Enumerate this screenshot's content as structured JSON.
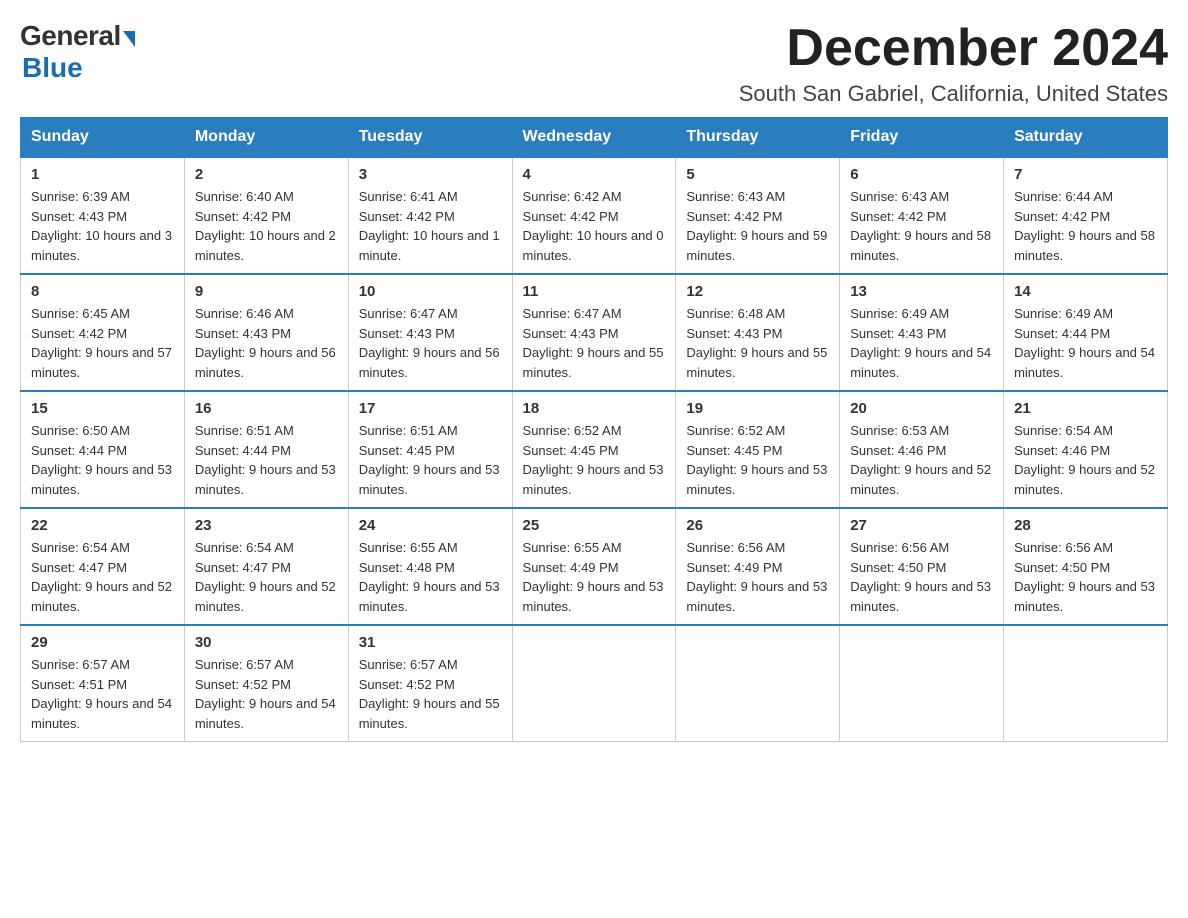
{
  "logo": {
    "general": "General",
    "blue": "Blue"
  },
  "title": {
    "month": "December 2024",
    "location": "South San Gabriel, California, United States"
  },
  "weekdays": [
    "Sunday",
    "Monday",
    "Tuesday",
    "Wednesday",
    "Thursday",
    "Friday",
    "Saturday"
  ],
  "weeks": [
    [
      {
        "day": "1",
        "sunrise": "6:39 AM",
        "sunset": "4:43 PM",
        "daylight": "10 hours and 3 minutes."
      },
      {
        "day": "2",
        "sunrise": "6:40 AM",
        "sunset": "4:42 PM",
        "daylight": "10 hours and 2 minutes."
      },
      {
        "day": "3",
        "sunrise": "6:41 AM",
        "sunset": "4:42 PM",
        "daylight": "10 hours and 1 minute."
      },
      {
        "day": "4",
        "sunrise": "6:42 AM",
        "sunset": "4:42 PM",
        "daylight": "10 hours and 0 minutes."
      },
      {
        "day": "5",
        "sunrise": "6:43 AM",
        "sunset": "4:42 PM",
        "daylight": "9 hours and 59 minutes."
      },
      {
        "day": "6",
        "sunrise": "6:43 AM",
        "sunset": "4:42 PM",
        "daylight": "9 hours and 58 minutes."
      },
      {
        "day": "7",
        "sunrise": "6:44 AM",
        "sunset": "4:42 PM",
        "daylight": "9 hours and 58 minutes."
      }
    ],
    [
      {
        "day": "8",
        "sunrise": "6:45 AM",
        "sunset": "4:42 PM",
        "daylight": "9 hours and 57 minutes."
      },
      {
        "day": "9",
        "sunrise": "6:46 AM",
        "sunset": "4:43 PM",
        "daylight": "9 hours and 56 minutes."
      },
      {
        "day": "10",
        "sunrise": "6:47 AM",
        "sunset": "4:43 PM",
        "daylight": "9 hours and 56 minutes."
      },
      {
        "day": "11",
        "sunrise": "6:47 AM",
        "sunset": "4:43 PM",
        "daylight": "9 hours and 55 minutes."
      },
      {
        "day": "12",
        "sunrise": "6:48 AM",
        "sunset": "4:43 PM",
        "daylight": "9 hours and 55 minutes."
      },
      {
        "day": "13",
        "sunrise": "6:49 AM",
        "sunset": "4:43 PM",
        "daylight": "9 hours and 54 minutes."
      },
      {
        "day": "14",
        "sunrise": "6:49 AM",
        "sunset": "4:44 PM",
        "daylight": "9 hours and 54 minutes."
      }
    ],
    [
      {
        "day": "15",
        "sunrise": "6:50 AM",
        "sunset": "4:44 PM",
        "daylight": "9 hours and 53 minutes."
      },
      {
        "day": "16",
        "sunrise": "6:51 AM",
        "sunset": "4:44 PM",
        "daylight": "9 hours and 53 minutes."
      },
      {
        "day": "17",
        "sunrise": "6:51 AM",
        "sunset": "4:45 PM",
        "daylight": "9 hours and 53 minutes."
      },
      {
        "day": "18",
        "sunrise": "6:52 AM",
        "sunset": "4:45 PM",
        "daylight": "9 hours and 53 minutes."
      },
      {
        "day": "19",
        "sunrise": "6:52 AM",
        "sunset": "4:45 PM",
        "daylight": "9 hours and 53 minutes."
      },
      {
        "day": "20",
        "sunrise": "6:53 AM",
        "sunset": "4:46 PM",
        "daylight": "9 hours and 52 minutes."
      },
      {
        "day": "21",
        "sunrise": "6:54 AM",
        "sunset": "4:46 PM",
        "daylight": "9 hours and 52 minutes."
      }
    ],
    [
      {
        "day": "22",
        "sunrise": "6:54 AM",
        "sunset": "4:47 PM",
        "daylight": "9 hours and 52 minutes."
      },
      {
        "day": "23",
        "sunrise": "6:54 AM",
        "sunset": "4:47 PM",
        "daylight": "9 hours and 52 minutes."
      },
      {
        "day": "24",
        "sunrise": "6:55 AM",
        "sunset": "4:48 PM",
        "daylight": "9 hours and 53 minutes."
      },
      {
        "day": "25",
        "sunrise": "6:55 AM",
        "sunset": "4:49 PM",
        "daylight": "9 hours and 53 minutes."
      },
      {
        "day": "26",
        "sunrise": "6:56 AM",
        "sunset": "4:49 PM",
        "daylight": "9 hours and 53 minutes."
      },
      {
        "day": "27",
        "sunrise": "6:56 AM",
        "sunset": "4:50 PM",
        "daylight": "9 hours and 53 minutes."
      },
      {
        "day": "28",
        "sunrise": "6:56 AM",
        "sunset": "4:50 PM",
        "daylight": "9 hours and 53 minutes."
      }
    ],
    [
      {
        "day": "29",
        "sunrise": "6:57 AM",
        "sunset": "4:51 PM",
        "daylight": "9 hours and 54 minutes."
      },
      {
        "day": "30",
        "sunrise": "6:57 AM",
        "sunset": "4:52 PM",
        "daylight": "9 hours and 54 minutes."
      },
      {
        "day": "31",
        "sunrise": "6:57 AM",
        "sunset": "4:52 PM",
        "daylight": "9 hours and 55 minutes."
      },
      null,
      null,
      null,
      null
    ]
  ],
  "labels": {
    "sunrise": "Sunrise:",
    "sunset": "Sunset:",
    "daylight": "Daylight:"
  }
}
